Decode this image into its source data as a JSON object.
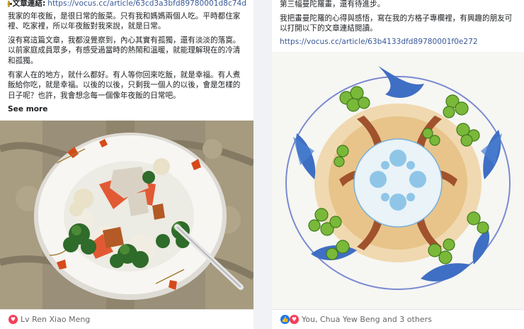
{
  "left_post": {
    "link_label": "文章連結:",
    "link_url": "https://vocus.cc/article/63cd3a3bfd89780001d8c74d",
    "paragraphs": [
      "我家的年夜飯，是很日常的飯菜。只有我和媽媽兩個人吃。平時都住家裡、吃家裡，所以年夜飯對我來說，就是日常。",
      "沒有寫這篇文章，我都沒覺察到，內心其實有孤獨，還有淡淡的落寞。以前家庭成員眾多，有感受過當時的熱鬧和溫暖，就能理解現在的冷清和孤獨。",
      "有家人在的地方，就什么都好。有人等你回來吃飯，就是幸福。有人煮飯給你吃，就是幸福。以後的以後，只剩我一個人的以後，會是怎樣的日子呢？也許，我會想念每一個像年夜飯的日常吧。"
    ],
    "see_more": "See more",
    "reactions": "Lv Ren Xiao Meng"
  },
  "right_post": {
    "paragraphs": [
      "第三幅曼陀羅畫，還有待進步。",
      "我把畫曼陀羅的心得與感悟，寫在我的方格子專欄裡，有興趣的朋友可以打開以下的文章連結閱讀。"
    ],
    "link_url": "https://vocus.cc/article/63b4133dfd89780001f0e272",
    "reactions": "You, Chua Yew Beng and 3 others"
  },
  "colors": {
    "link": "#385898",
    "heart": "#f33e58",
    "like": "#1877f2"
  },
  "icons": [
    "sun-bullet-icon",
    "heart-reaction-icon",
    "like-reaction-icon"
  ]
}
